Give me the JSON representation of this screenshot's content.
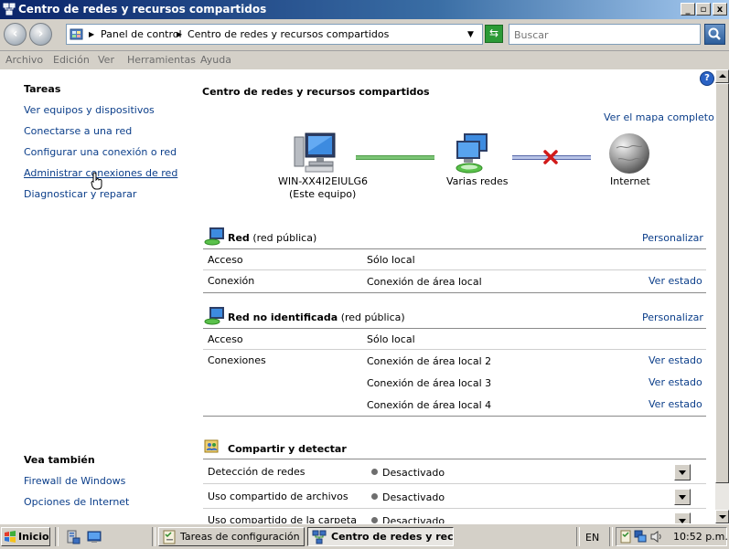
{
  "window": {
    "title": "Centro de redes y recursos compartidos",
    "min_label": "_",
    "max_label": "▫",
    "close_label": "x"
  },
  "address": {
    "crumb1": "Panel de control",
    "crumb2": "Centro de redes y recursos compartidos",
    "search_placeholder": "Buscar"
  },
  "menu": [
    "Archivo",
    "Edición",
    "Ver",
    "Herramientas",
    "Ayuda"
  ],
  "left": {
    "tasks_title": "Tareas",
    "tasks": [
      "Ver equipos y dispositivos",
      "Conectarse a una red",
      "Configurar una conexión o red",
      "Administrar conexiones de red",
      "Diagnosticar y reparar"
    ],
    "see_also_title": "Vea también",
    "see_also": [
      "Firewall de Windows",
      "Opciones de Internet"
    ]
  },
  "main": {
    "title": "Centro de redes y recursos compartidos",
    "map_link": "Ver el mapa completo",
    "map": {
      "computer_name": "WIN-XX4I2EIULG6",
      "computer_sub": "(Este equipo)",
      "networks": "Varias redes",
      "internet": "Internet"
    },
    "net1": {
      "name": "Red",
      "type": "(red pública)",
      "customize": "Personalizar",
      "rows": [
        {
          "label": "Acceso",
          "value": "Sólo local",
          "link": ""
        },
        {
          "label": "Conexión",
          "value": "Conexión de área local",
          "link": "Ver estado"
        }
      ]
    },
    "net2": {
      "name": "Red no identificada",
      "type": "(red pública)",
      "customize": "Personalizar",
      "rows": [
        {
          "label": "Acceso",
          "value": "Sólo local",
          "link": ""
        },
        {
          "label": "Conexiones",
          "value": "Conexión de área local 2",
          "link": "Ver estado"
        },
        {
          "label": "",
          "value": "Conexión de área local 3",
          "link": "Ver estado"
        },
        {
          "label": "",
          "value": "Conexión de área local 4",
          "link": "Ver estado"
        }
      ]
    },
    "sharing": {
      "title": "Compartir y detectar",
      "rows": [
        {
          "label": "Detección de redes",
          "value": "Desactivado"
        },
        {
          "label": "Uso compartido de archivos",
          "value": "Desactivado"
        },
        {
          "label": "Uso compartido de la carpeta",
          "value": "Desactivado"
        }
      ]
    }
  },
  "taskbar": {
    "start": "Inicio",
    "task1": "Tareas de configuración i...",
    "task2": "Centro de redes y rec...",
    "lang": "EN",
    "clock": "10:52 p.m."
  }
}
